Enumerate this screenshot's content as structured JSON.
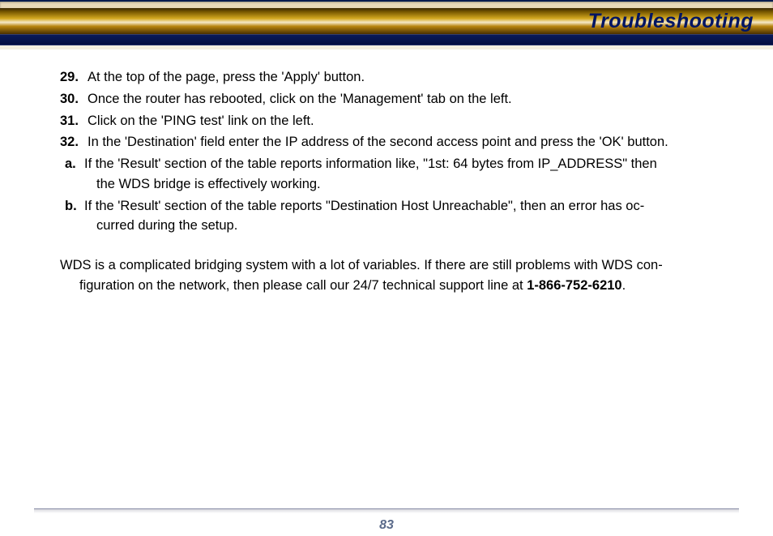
{
  "header": {
    "title": "Troubleshooting"
  },
  "items": {
    "29": {
      "n": "29.",
      "t": "At the top of the page, press the 'Apply' button."
    },
    "30": {
      "n": "30.",
      "t": "Once the router has rebooted, click on the 'Management' tab on the left."
    },
    "31": {
      "n": "31.",
      "t": "Click on the 'PING test' link on the left."
    },
    "32": {
      "n": "32.",
      "t": "In the 'Destination' field enter the IP address of the second access point and press the 'OK' button."
    },
    "a": {
      "l": "a.",
      "l1": "If the 'Result' section of the table reports information like, \"1st: 64 bytes from IP_ADDRESS\" then",
      "l2": "the WDS bridge is effectively working."
    },
    "b": {
      "l": "b.",
      "l1": "If the 'Result' section of the table reports \"Destination Host Unreachable\", then an error has oc-",
      "l2": "curred during the setup."
    }
  },
  "paragraph": {
    "l1": "WDS is a complicated bridging system with a lot of variables. If there are still problems with WDS con-",
    "l2_a": "figuration on the network, then please call our 24/7 technical support line at ",
    "l2_b": "1-866-752-6210",
    "l2_c": "."
  },
  "footer": {
    "page": "83"
  }
}
